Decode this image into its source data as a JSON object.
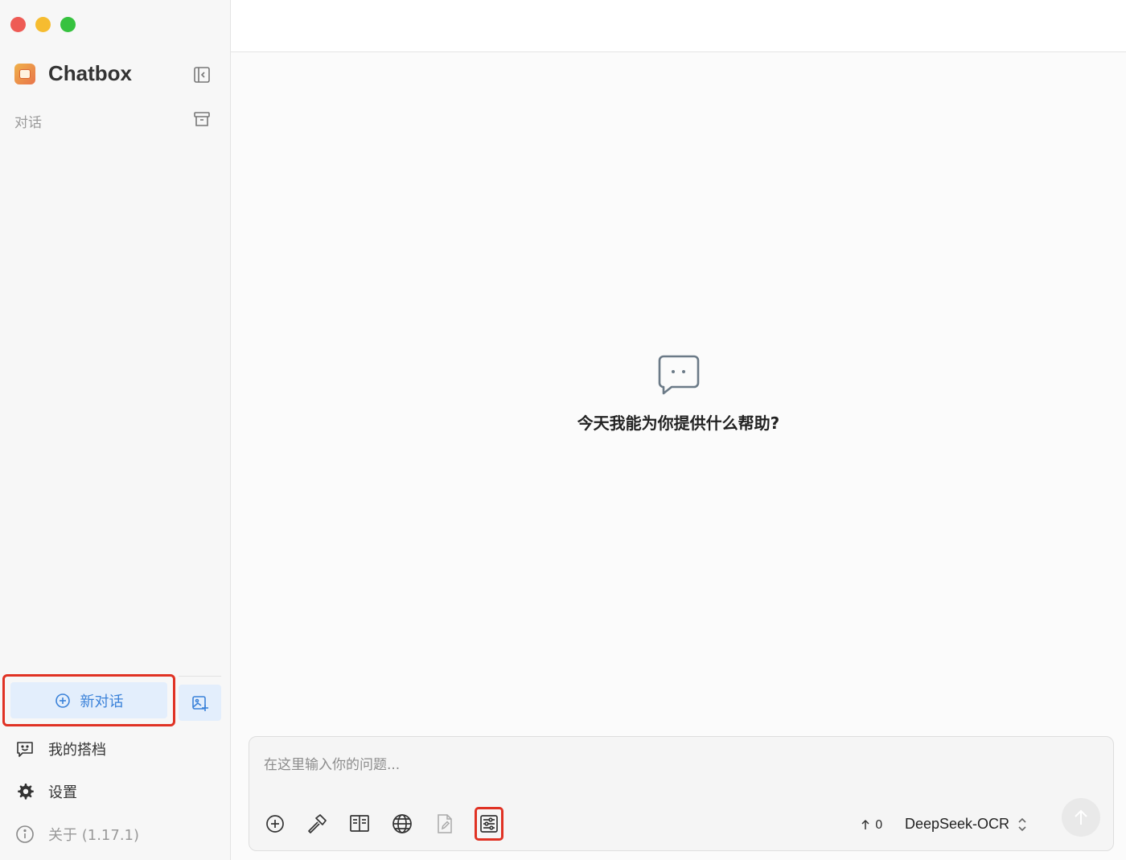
{
  "window": {
    "controls": [
      "close",
      "minimize",
      "maximize"
    ]
  },
  "sidebar": {
    "brand": {
      "name": "Chatbox"
    },
    "section_label": "对话",
    "new_chat_label": "新对话",
    "nav": {
      "partners": "我的搭档",
      "settings": "设置",
      "about": "关于 (1.17.1)"
    }
  },
  "main": {
    "welcome_text": "今天我能为你提供什么帮助?",
    "composer": {
      "placeholder": "在这里输入你的问题...",
      "token_count": "0",
      "model": "DeepSeek-OCR"
    }
  },
  "colors": {
    "accent": "#3b82d9",
    "highlight": "#e03224",
    "sidebar_bg": "#f7f7f7"
  }
}
